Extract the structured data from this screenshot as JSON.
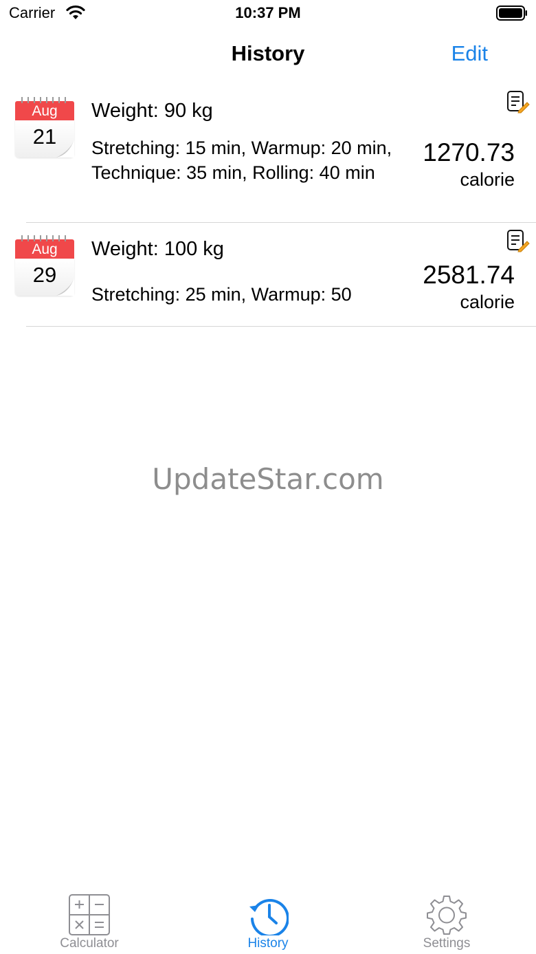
{
  "status_bar": {
    "carrier": "Carrier",
    "time": "10:37 PM"
  },
  "nav": {
    "title": "History",
    "edit_label": "Edit"
  },
  "entries": [
    {
      "month": "Aug",
      "day": "21",
      "weight": "Weight: 90 kg",
      "details": "Stretching: 15 min, Warmup: 20 min, Technique: 35 min, Rolling: 40 min",
      "calories": "1270.73",
      "unit": "calorie"
    },
    {
      "month": "Aug",
      "day": "29",
      "weight": "Weight: 100 kg",
      "details": "Stretching: 25 min, Warmup: 50",
      "calories": "2581.74",
      "unit": "calorie"
    }
  ],
  "watermark": "UpdateStar.com",
  "tabs": [
    {
      "label": "Calculator",
      "icon": "calculator-icon",
      "active": false
    },
    {
      "label": "History",
      "icon": "history-icon",
      "active": true
    },
    {
      "label": "Settings",
      "icon": "gear-icon",
      "active": false
    }
  ],
  "colors": {
    "accent": "#1a83e8",
    "calendar_red": "#f0484a",
    "inactive_tab": "#8e8e93",
    "note_pencil": "#f5a623"
  }
}
